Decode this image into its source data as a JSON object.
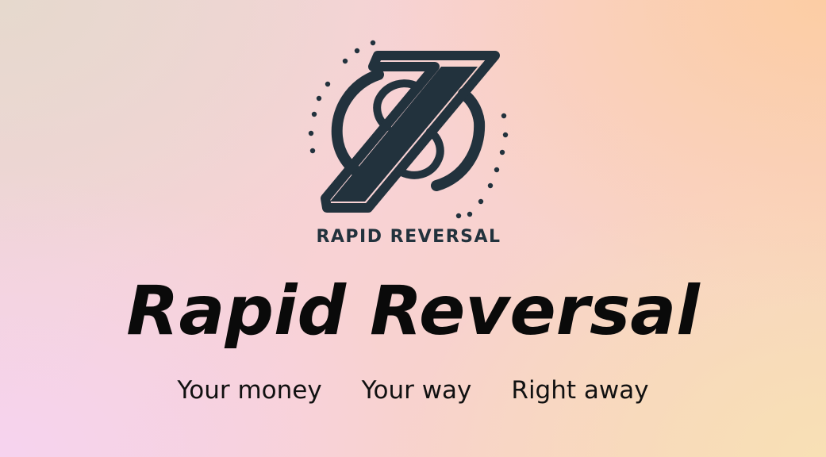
{
  "logo": {
    "caption": "RAPID REVERSAL",
    "icon": "z-reversal-logo-icon",
    "color": "#22323d"
  },
  "headline": "Rapid Reversal",
  "taglines": [
    "Your money",
    "Your way",
    "Right away"
  ]
}
